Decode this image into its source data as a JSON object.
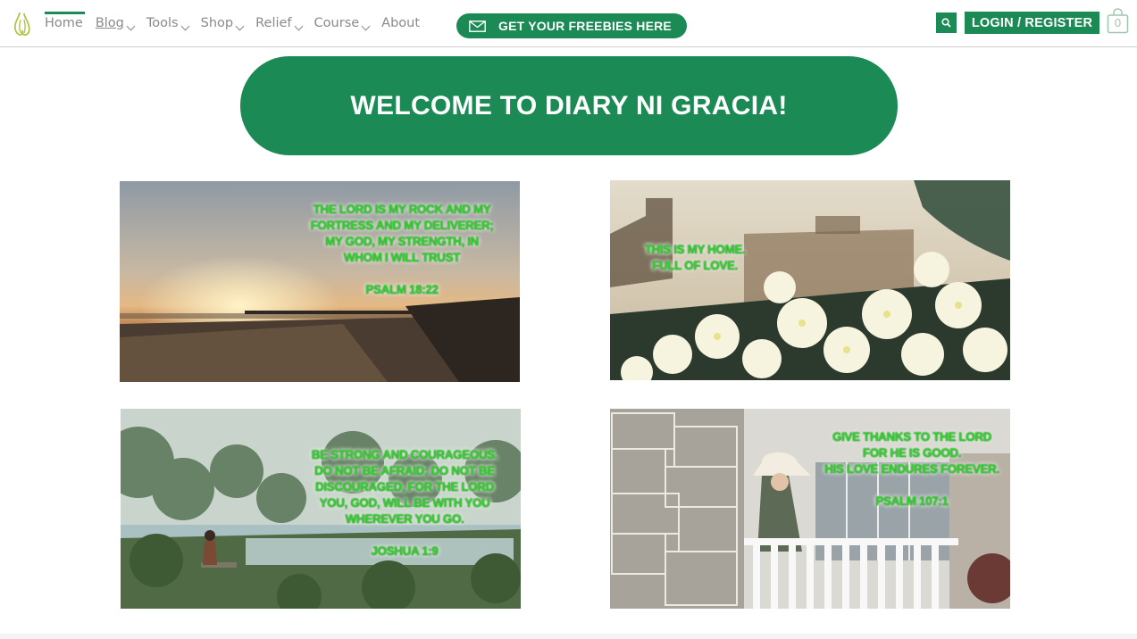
{
  "header": {
    "logo_icon": "pear-logo-icon",
    "nav": [
      {
        "label": "Home",
        "dropdown": false
      },
      {
        "label": "Blog",
        "dropdown": true
      },
      {
        "label": "Tools",
        "dropdown": true
      },
      {
        "label": "Shop",
        "dropdown": true
      },
      {
        "label": "Relief",
        "dropdown": true
      },
      {
        "label": "Course",
        "dropdown": true
      },
      {
        "label": "About",
        "dropdown": false
      }
    ],
    "freebies_label": "GET YOUR FREEBIES HERE",
    "login_label": "LOGIN / REGISTER",
    "cart_count": "0"
  },
  "banner": {
    "title": "WELCOME TO DIARY NI GRACIA!"
  },
  "cards": [
    {
      "lines": [
        "THE LORD IS MY ROCK AND MY",
        "FORTRESS AND MY DELIVERER;",
        "MY GOD, MY STRENGTH, IN",
        "WHOM I WILL TRUST"
      ],
      "ref": "PSALM 18:22"
    },
    {
      "lines": [
        "THIS IS MY HOME.",
        "FULL OF LOVE."
      ],
      "ref": ""
    },
    {
      "lines": [
        "BE STRONG AND COURAGEOUS.",
        "DO NOT BE AFRAID; DO NOT BE",
        "DISCOURAGED, FOR THE LORD",
        "YOU, GOD, WILL BE WITH YOU",
        "WHEREVER YOU GO."
      ],
      "ref": "JOSHUA 1:9"
    },
    {
      "lines": [
        "GIVE THANKS TO THE LORD",
        "FOR HE IS GOOD.",
        "HIS LOVE ENDURES FOREVER."
      ],
      "ref": "PSALM 107:1"
    }
  ],
  "colors": {
    "brand_green": "#1b8a55",
    "verse_green": "#2fd22a"
  }
}
